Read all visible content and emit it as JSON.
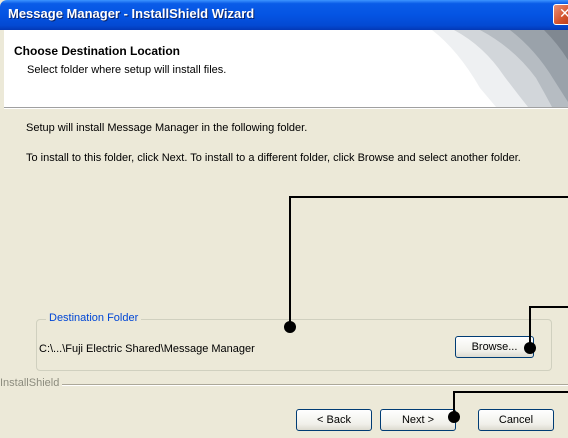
{
  "window": {
    "title": "Message Manager - InstallShield Wizard",
    "close_glyph": "✕"
  },
  "header": {
    "title": "Choose Destination Location",
    "subtitle": "Select folder where setup will install files."
  },
  "content": {
    "line1": "Setup will install Message Manager in the following folder.",
    "line2": "To install to this folder, click Next. To install to a different folder, click Browse and select another folder."
  },
  "destination": {
    "group_label": "Destination Folder",
    "path": "C:\\...\\Fuji Electric Shared\\Message Manager",
    "browse_label": "Browse..."
  },
  "footer": {
    "brand": "InstallShield",
    "back_label": "< Back",
    "next_label": "Next >",
    "cancel_label": "Cancel"
  },
  "colors": {
    "titlebar": "#0454e3",
    "dialog_bg": "#ece9d8",
    "group_label": "#0046d5",
    "annotation": "#000000"
  },
  "icons": {
    "header_art": "installshield-header-graphic",
    "close": "close-icon"
  }
}
